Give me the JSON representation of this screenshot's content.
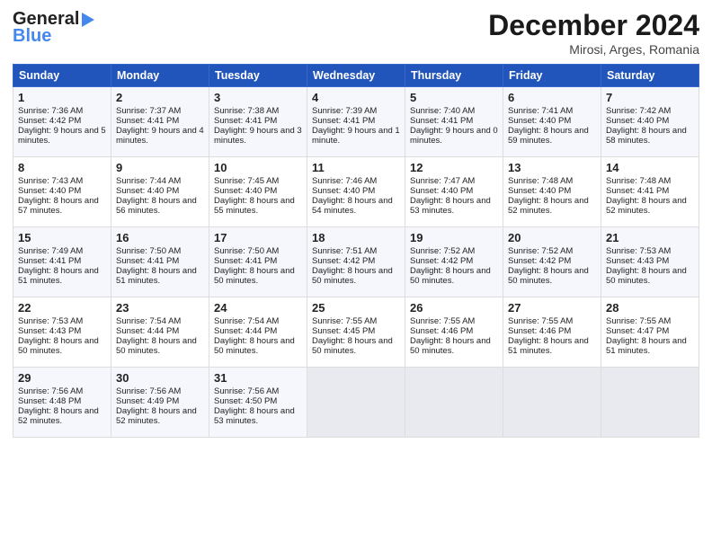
{
  "header": {
    "logo_line1": "General",
    "logo_line2": "Blue",
    "month_title": "December 2024",
    "location": "Mirosi, Arges, Romania"
  },
  "weekdays": [
    "Sunday",
    "Monday",
    "Tuesday",
    "Wednesday",
    "Thursday",
    "Friday",
    "Saturday"
  ],
  "weeks": [
    [
      {
        "day": "1",
        "sr": "7:36 AM",
        "ss": "4:42 PM",
        "dl": "9 hours and 5 minutes."
      },
      {
        "day": "2",
        "sr": "7:37 AM",
        "ss": "4:41 PM",
        "dl": "9 hours and 4 minutes."
      },
      {
        "day": "3",
        "sr": "7:38 AM",
        "ss": "4:41 PM",
        "dl": "9 hours and 3 minutes."
      },
      {
        "day": "4",
        "sr": "7:39 AM",
        "ss": "4:41 PM",
        "dl": "9 hours and 1 minute."
      },
      {
        "day": "5",
        "sr": "7:40 AM",
        "ss": "4:41 PM",
        "dl": "9 hours and 0 minutes."
      },
      {
        "day": "6",
        "sr": "7:41 AM",
        "ss": "4:40 PM",
        "dl": "8 hours and 59 minutes."
      },
      {
        "day": "7",
        "sr": "7:42 AM",
        "ss": "4:40 PM",
        "dl": "8 hours and 58 minutes."
      }
    ],
    [
      {
        "day": "8",
        "sr": "7:43 AM",
        "ss": "4:40 PM",
        "dl": "8 hours and 57 minutes."
      },
      {
        "day": "9",
        "sr": "7:44 AM",
        "ss": "4:40 PM",
        "dl": "8 hours and 56 minutes."
      },
      {
        "day": "10",
        "sr": "7:45 AM",
        "ss": "4:40 PM",
        "dl": "8 hours and 55 minutes."
      },
      {
        "day": "11",
        "sr": "7:46 AM",
        "ss": "4:40 PM",
        "dl": "8 hours and 54 minutes."
      },
      {
        "day": "12",
        "sr": "7:47 AM",
        "ss": "4:40 PM",
        "dl": "8 hours and 53 minutes."
      },
      {
        "day": "13",
        "sr": "7:48 AM",
        "ss": "4:40 PM",
        "dl": "8 hours and 52 minutes."
      },
      {
        "day": "14",
        "sr": "7:48 AM",
        "ss": "4:41 PM",
        "dl": "8 hours and 52 minutes."
      }
    ],
    [
      {
        "day": "15",
        "sr": "7:49 AM",
        "ss": "4:41 PM",
        "dl": "8 hours and 51 minutes."
      },
      {
        "day": "16",
        "sr": "7:50 AM",
        "ss": "4:41 PM",
        "dl": "8 hours and 51 minutes."
      },
      {
        "day": "17",
        "sr": "7:50 AM",
        "ss": "4:41 PM",
        "dl": "8 hours and 50 minutes."
      },
      {
        "day": "18",
        "sr": "7:51 AM",
        "ss": "4:42 PM",
        "dl": "8 hours and 50 minutes."
      },
      {
        "day": "19",
        "sr": "7:52 AM",
        "ss": "4:42 PM",
        "dl": "8 hours and 50 minutes."
      },
      {
        "day": "20",
        "sr": "7:52 AM",
        "ss": "4:42 PM",
        "dl": "8 hours and 50 minutes."
      },
      {
        "day": "21",
        "sr": "7:53 AM",
        "ss": "4:43 PM",
        "dl": "8 hours and 50 minutes."
      }
    ],
    [
      {
        "day": "22",
        "sr": "7:53 AM",
        "ss": "4:43 PM",
        "dl": "8 hours and 50 minutes."
      },
      {
        "day": "23",
        "sr": "7:54 AM",
        "ss": "4:44 PM",
        "dl": "8 hours and 50 minutes."
      },
      {
        "day": "24",
        "sr": "7:54 AM",
        "ss": "4:44 PM",
        "dl": "8 hours and 50 minutes."
      },
      {
        "day": "25",
        "sr": "7:55 AM",
        "ss": "4:45 PM",
        "dl": "8 hours and 50 minutes."
      },
      {
        "day": "26",
        "sr": "7:55 AM",
        "ss": "4:46 PM",
        "dl": "8 hours and 50 minutes."
      },
      {
        "day": "27",
        "sr": "7:55 AM",
        "ss": "4:46 PM",
        "dl": "8 hours and 51 minutes."
      },
      {
        "day": "28",
        "sr": "7:55 AM",
        "ss": "4:47 PM",
        "dl": "8 hours and 51 minutes."
      }
    ],
    [
      {
        "day": "29",
        "sr": "7:56 AM",
        "ss": "4:48 PM",
        "dl": "8 hours and 52 minutes."
      },
      {
        "day": "30",
        "sr": "7:56 AM",
        "ss": "4:49 PM",
        "dl": "8 hours and 52 minutes."
      },
      {
        "day": "31",
        "sr": "7:56 AM",
        "ss": "4:50 PM",
        "dl": "8 hours and 53 minutes."
      },
      null,
      null,
      null,
      null
    ]
  ]
}
